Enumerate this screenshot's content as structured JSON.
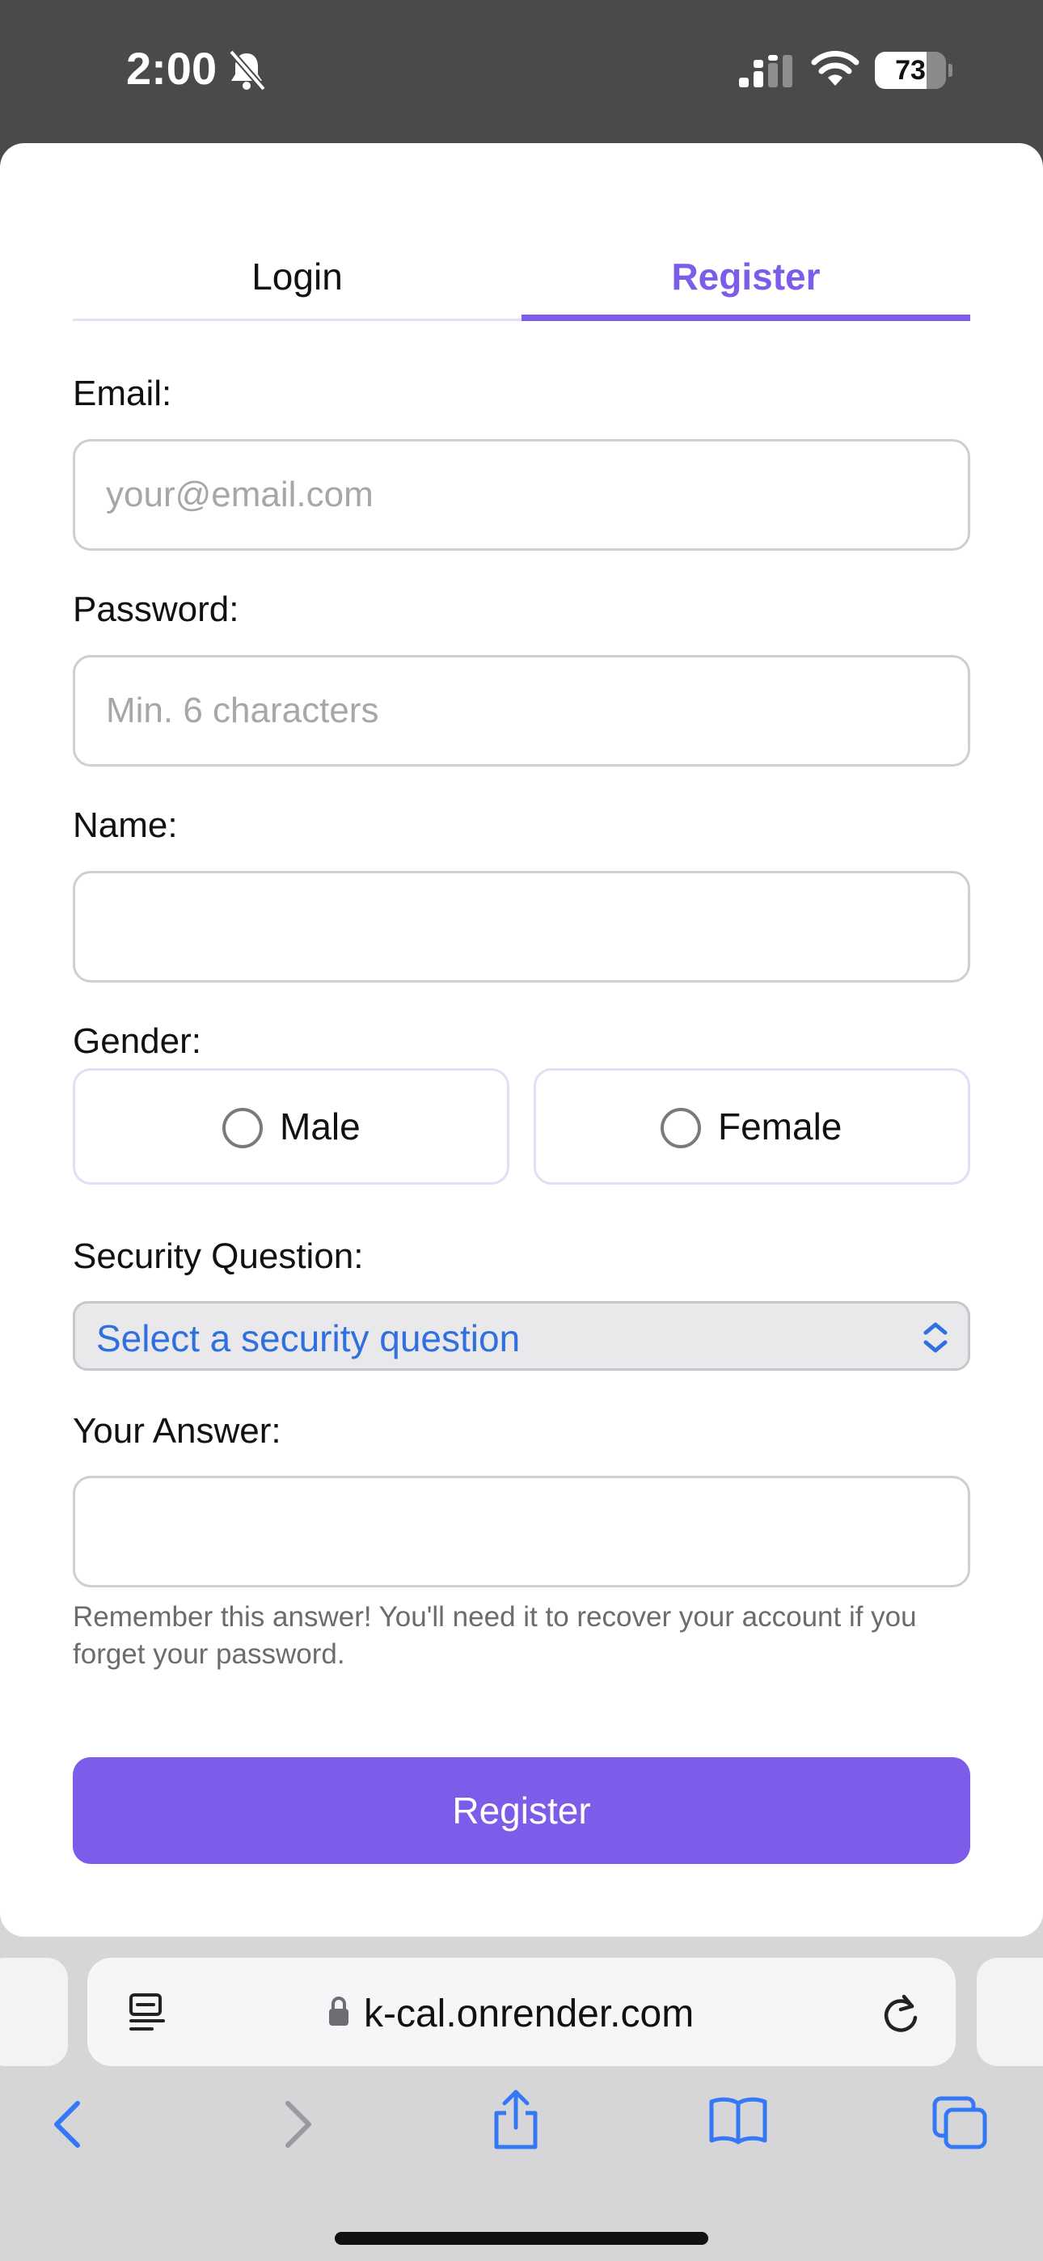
{
  "status_bar": {
    "time": "2:00",
    "battery": "73",
    "battery_level": 0.73,
    "icons": [
      "bell-slash-icon",
      "cellular-signal-icon",
      "wifi-icon",
      "battery-icon"
    ]
  },
  "tabs": [
    {
      "label": "Login",
      "active": false
    },
    {
      "label": "Register",
      "active": true
    }
  ],
  "form": {
    "email": {
      "label": "Email:",
      "placeholder": "your@email.com",
      "value": ""
    },
    "password": {
      "label": "Password:",
      "placeholder": "Min. 6 characters",
      "value": ""
    },
    "name": {
      "label": "Name:",
      "placeholder": "",
      "value": ""
    },
    "gender": {
      "label": "Gender:",
      "options": [
        "Male",
        "Female"
      ],
      "selected": null
    },
    "security_question": {
      "label": "Security Question:",
      "selected": "Select a security question"
    },
    "answer": {
      "label": "Your Answer:",
      "placeholder": "",
      "value": "",
      "hint": "Remember this answer! You'll need it to recover your account if you forget your password."
    },
    "submit_label": "Register"
  },
  "browser": {
    "url": "k-cal.onrender.com",
    "toolbar_icons": [
      "back-icon",
      "forward-icon",
      "share-icon",
      "bookmarks-icon",
      "tabs-icon"
    ]
  },
  "colors": {
    "accent": "#7c5ce8",
    "link_blue": "#2f6fe0",
    "status_bar_bg": "#4a4a4c",
    "toolbar_icon_blue": "#3478f6"
  }
}
